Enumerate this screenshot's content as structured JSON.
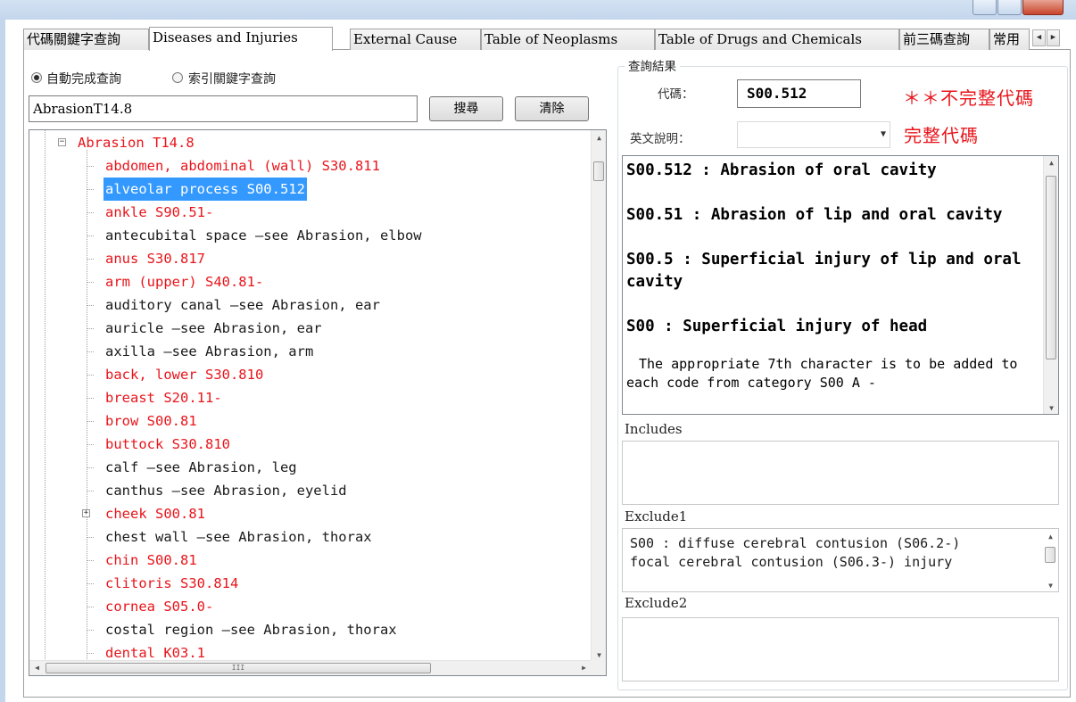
{
  "tabs": [
    "代碼關鍵字查詢",
    "Diseases and Injuries",
    "External Cause",
    "Table of Neoplasms",
    "Table of Drugs and Chemicals",
    "前三碼查詢",
    "常用"
  ],
  "active_tab": "Diseases and Injuries",
  "search": {
    "radio_auto": "自動完成查詢",
    "radio_index": "索引關鍵字查詢",
    "radio_selected": "自動完成查詢",
    "value": "AbrasionT14.8",
    "search_button": "搜尋",
    "clear_button": "清除"
  },
  "tree": {
    "root": "Abrasion T14.8",
    "items": [
      {
        "label": "abdomen, abdominal (wall) S30.811",
        "color": "red"
      },
      {
        "label": "alveolar process S00.512",
        "color": "selected"
      },
      {
        "label": "ankle S90.51-",
        "color": "red"
      },
      {
        "label": "antecubital space —see Abrasion, elbow",
        "color": "black"
      },
      {
        "label": "anus S30.817",
        "color": "red"
      },
      {
        "label": "arm (upper) S40.81-",
        "color": "red"
      },
      {
        "label": "auditory canal —see Abrasion, ear",
        "color": "black"
      },
      {
        "label": "auricle —see Abrasion, ear",
        "color": "black"
      },
      {
        "label": "axilla —see Abrasion, arm",
        "color": "black"
      },
      {
        "label": "back, lower S30.810",
        "color": "red"
      },
      {
        "label": "breast S20.11-",
        "color": "red"
      },
      {
        "label": "brow S00.81",
        "color": "red"
      },
      {
        "label": "buttock S30.810",
        "color": "red"
      },
      {
        "label": "calf —see Abrasion, leg",
        "color": "black"
      },
      {
        "label": "canthus —see Abrasion, eyelid",
        "color": "black"
      },
      {
        "label": "cheek S00.81",
        "color": "red",
        "expandable": true
      },
      {
        "label": "chest wall —see Abrasion, thorax",
        "color": "black"
      },
      {
        "label": "chin S00.81",
        "color": "red"
      },
      {
        "label": "clitoris S30.814",
        "color": "red"
      },
      {
        "label": "cornea S05.0-",
        "color": "red"
      },
      {
        "label": "costal region —see Abrasion, thorax",
        "color": "black"
      },
      {
        "label": "dental K03.1",
        "color": "red"
      }
    ],
    "hscroll_grip": "III"
  },
  "result": {
    "group_title": "查詢結果",
    "code_label": "代碼：",
    "code_value": "S00.512",
    "desc_label": "英文說明：",
    "desc_combo_value": "",
    "warn_incomplete": "＊＊不完整代碼",
    "warn_complete": "完整代碼",
    "descriptions": [
      "S00.512 : Abrasion of oral cavity",
      "S00.51 : Abrasion of lip and oral cavity",
      "S00.5 : Superficial injury of lip and oral cavity",
      "S00 : Superficial injury of head"
    ],
    "note": "The appropriate 7th character is to be added to each code from category S00 A -",
    "includes_label": "Includes",
    "includes_text": "",
    "exclude1_label": "Exclude1",
    "exclude1_lines": [
      "S00 : diffuse cerebral contusion (S06.2-)",
      "focal cerebral contusion (S06.3-) injury"
    ],
    "exclude2_label": "Exclude2",
    "exclude2_text": ""
  },
  "colors": {
    "red_text": "#e8151b",
    "selection": "#3399ff",
    "window_frame": "#c4d6ec"
  }
}
